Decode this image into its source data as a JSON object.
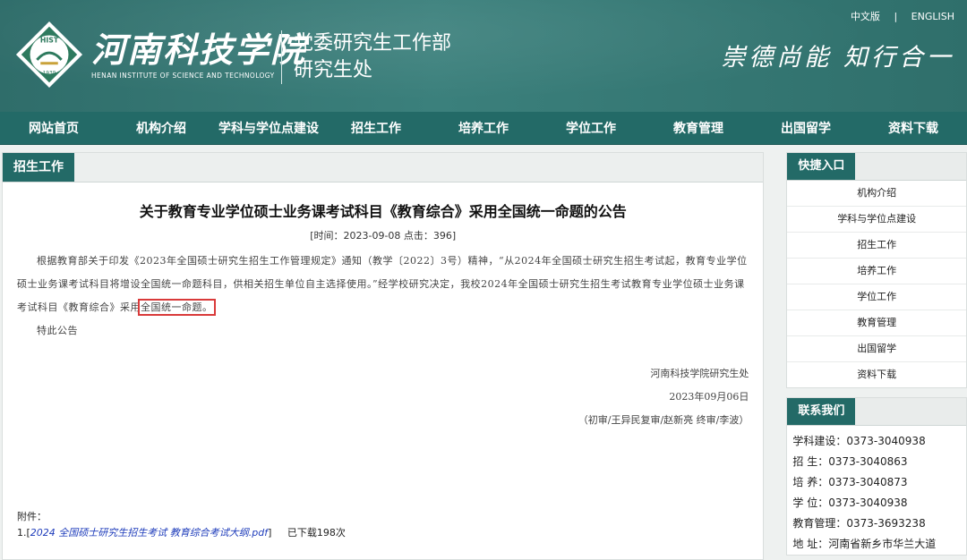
{
  "header": {
    "emblem_text": "HIST",
    "emblem_year": "1939",
    "school_cn": "河南科技学院",
    "school_en": "HENAN INSTITUTE OF SCIENCE AND TECHNOLOGY",
    "dept_line1": "党委研究生工作部",
    "dept_line2": "研究生处",
    "motto": "崇德尚能 知行合一",
    "lang_cn": "中文版",
    "lang_sep": "|",
    "lang_en": "ENGLISH"
  },
  "nav": [
    "网站首页",
    "机构介绍",
    "学科与学位点建设",
    "招生工作",
    "培养工作",
    "学位工作",
    "教育管理",
    "出国留学",
    "资料下载"
  ],
  "content": {
    "tab": "招生工作",
    "title": "关于教育专业学位硕士业务课考试科目《教育综合》采用全国统一命题的公告",
    "meta": "[时间：2023-09-08 点击：396]",
    "para1_pre": "根据教育部关于印发《2023年全国硕士研究生招生工作管理规定》通知（教学〔2022〕3号）精神，“从2024年全国硕士研究生招生考试起，教育专业学位硕士业务课考试科目将增设全国统一命题科目，供相关招生单位自主选择使用。”经学校研究决定，我校2024年全国硕士研究生招生考试教育专业学位硕士业务课考试科目《教育综合》采用",
    "para1_hl": "全国统一命题。",
    "para2": "特此公告",
    "sign1": "河南科技学院研究生处",
    "sign2": "2023年09月06日",
    "sign3": "（初审/王异民复审/赵新亮 终审/李波）",
    "attach_label": "附件：",
    "attach_prefix": "1.[",
    "attach_link": "2024 全国硕士研究生招生考试 教育综合考试大纲.pdf",
    "attach_suffix": "]",
    "attach_count": "已下载198次"
  },
  "sidebar": {
    "quick_title": "快捷入口",
    "quick_links": [
      "机构介绍",
      "学科与学位点建设",
      "招生工作",
      "培养工作",
      "学位工作",
      "教育管理",
      "出国留学",
      "资料下载"
    ],
    "contact_title": "联系我们",
    "contacts": [
      "学科建设：0373-3040938",
      "招 生：0373-3040863",
      "培 养：0373-3040873",
      "学 位：0373-3040938",
      "教育管理：0373-3693238",
      "地 址：河南省新乡市华兰大道"
    ]
  }
}
